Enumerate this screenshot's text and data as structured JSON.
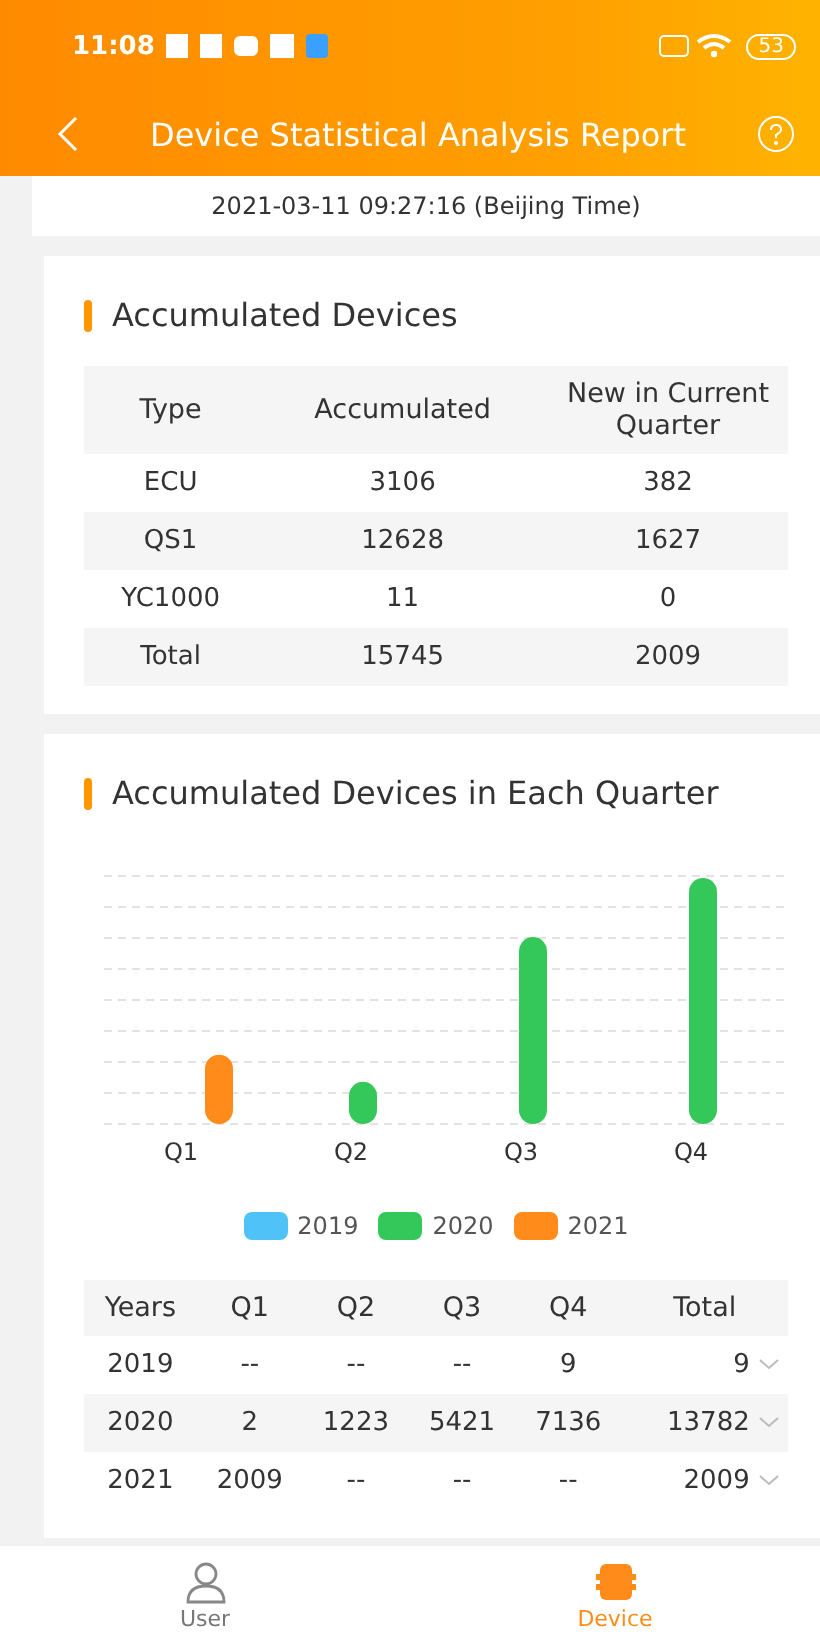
{
  "status_bar": {
    "time": "11:08",
    "battery": "53"
  },
  "nav": {
    "title": "Device Statistical Analysis Report"
  },
  "timestamp": "2021-03-11 09:27:16 (Beijing Time)",
  "accumulated": {
    "title": "Accumulated Devices",
    "columns": [
      "Type",
      "Accumulated",
      "New in Current Quarter"
    ],
    "rows": [
      [
        "ECU",
        "3106",
        "382"
      ],
      [
        "QS1",
        "12628",
        "1627"
      ],
      [
        "YC1000",
        "11",
        "0"
      ],
      [
        "Total",
        "15745",
        "2009"
      ]
    ]
  },
  "quarterly": {
    "title": "Accumulated Devices in Each Quarter",
    "chart": {
      "categories": [
        "Q1",
        "Q2",
        "Q3",
        "Q4"
      ],
      "legend": [
        {
          "name": "2019",
          "color": "#4fc3f7"
        },
        {
          "name": "2020",
          "color": "#34c759"
        },
        {
          "name": "2021",
          "color": "#ff8c1a"
        }
      ]
    },
    "columns": [
      "Years",
      "Q1",
      "Q2",
      "Q3",
      "Q4",
      "Total"
    ],
    "rows": [
      {
        "cells": [
          "2019",
          "--",
          "--",
          "--",
          "9",
          "9"
        ],
        "expanded": false
      },
      {
        "cells": [
          "2020",
          "2",
          "1223",
          "5421",
          "7136",
          "13782"
        ],
        "expanded": false
      },
      {
        "cells": [
          "2021",
          "2009",
          "--",
          "--",
          "--",
          "2009"
        ],
        "expanded": false
      }
    ]
  },
  "tabbar": [
    {
      "label": "User",
      "kind": "user",
      "selected": false
    },
    {
      "label": "Device",
      "kind": "device",
      "selected": true
    }
  ]
}
